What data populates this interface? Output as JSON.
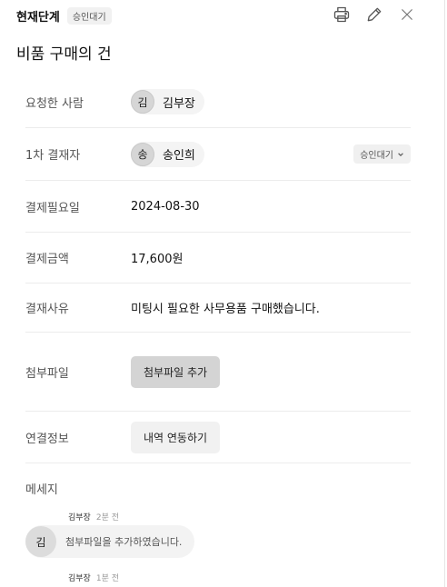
{
  "header": {
    "stage_title": "현재단계",
    "stage_badge": "승인대기",
    "actions": [
      {
        "name": "print-icon"
      },
      {
        "name": "pencil-icon"
      },
      {
        "name": "close-icon"
      }
    ]
  },
  "document": {
    "title": "비품 구매의 건"
  },
  "fields": {
    "requester": {
      "label": "요청한 사람",
      "avatar": "김",
      "name": "김부장"
    },
    "approver": {
      "label": "1차 결재자",
      "avatar": "송",
      "name": "송인희",
      "status": "승인대기"
    },
    "due_date": {
      "label": "결제필요일",
      "value": "2024-08-30"
    },
    "amount": {
      "label": "결제금액",
      "value": "17,600원"
    },
    "reason": {
      "label": "결재사유",
      "value": "미팅시 필요한 사무용품 구매했습니다."
    },
    "attachment": {
      "label": "첨부파일",
      "button": "첨부파일 추가"
    },
    "link": {
      "label": "연결정보",
      "button": "내역 연동하기"
    }
  },
  "messages": {
    "label": "메세지",
    "items": [
      {
        "author": "김부장",
        "time": "2분 전",
        "avatar": "김",
        "text": "첨부파일을 추가하였습니다."
      },
      {
        "author": "김부장",
        "time": "1분 전"
      }
    ]
  },
  "colors": {
    "badge_bg": "#f1f1f1",
    "button_gray": "#d4d4d4",
    "divider": "#ececec"
  }
}
